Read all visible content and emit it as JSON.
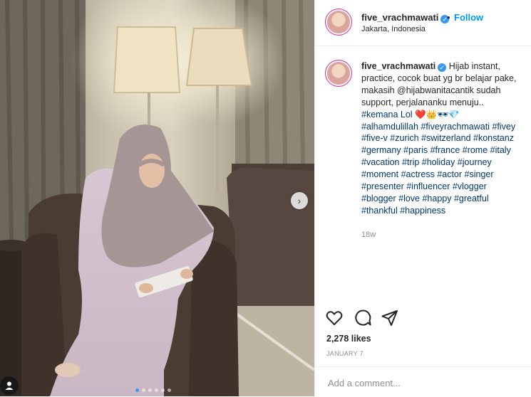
{
  "post": {
    "username": "five_vrachmawati",
    "location": "Jakarta, Indonesia",
    "follow_label": "Follow",
    "separator": "•",
    "caption_text": "Hijab instant, practice, cocok buat yg br belajar pake, makasih @hijabwanitacantik sudah support, perjalananku menuju.. ",
    "caption_emojis": "#kemana Lol ❤️👑🕶💎",
    "hashtags": "#alhamdulillah #fiveyrachmawati #fivey #five-v #zurich #switzerland #konstanz #germany #paris #france #rome #italy #vacation #trip #holiday #journey #moment #actress #actor #singer #presenter #influencer #vlogger #blogger #love #happy #greatful #thankful #happiness",
    "time_ago": "18w",
    "likes": "2,278 likes",
    "date": "JANUARY 7",
    "comment_placeholder": "Add a comment..."
  },
  "carousel": {
    "slide_count": 6,
    "active_index": 0
  },
  "colors": {
    "link": "#0095f6",
    "hashtag": "#00376b",
    "muted": "#8e8e8e",
    "border": "#efefef",
    "verified": "#3897f0"
  },
  "icons": [
    "heart-icon",
    "comment-icon",
    "share-icon",
    "chevron-right-icon",
    "user-tag-icon",
    "verified-badge-icon"
  ]
}
